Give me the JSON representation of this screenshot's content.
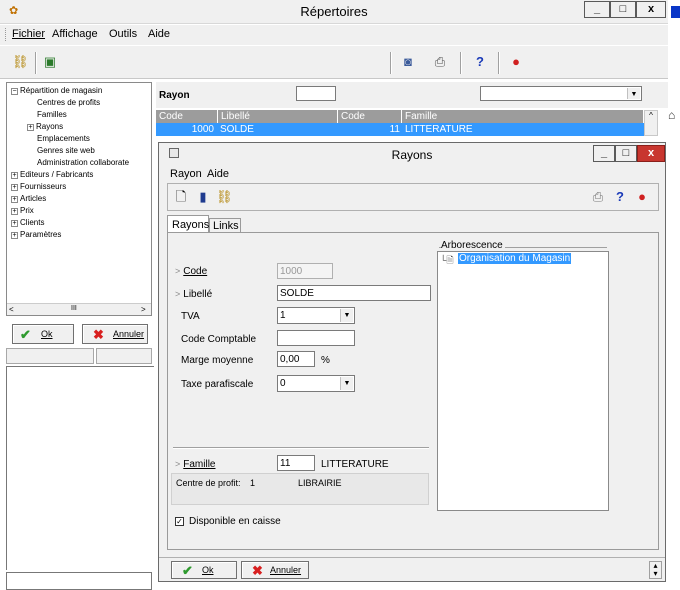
{
  "window": {
    "title": "Répertoires",
    "minimize": "_",
    "maximize": "□",
    "close": "x"
  },
  "menu": {
    "items": [
      {
        "label": "Fichier"
      },
      {
        "label": "Affichage"
      },
      {
        "label": "Outils"
      },
      {
        "label": "Aide"
      }
    ]
  },
  "tree": {
    "items": [
      {
        "label": "Répartition de magasin",
        "expander": "−"
      },
      {
        "label": "Centres de profits"
      },
      {
        "label": "Familles"
      },
      {
        "label": "Rayons",
        "expander": "+"
      },
      {
        "label": "Emplacements"
      },
      {
        "label": "Genres site web"
      },
      {
        "label": "Administration collaborate"
      },
      {
        "label": "Editeurs / Fabricants",
        "expander": "+"
      },
      {
        "label": "Fournisseurs",
        "expander": "+"
      },
      {
        "label": "Articles",
        "expander": "+"
      },
      {
        "label": "Prix",
        "expander": "+"
      },
      {
        "label": "Clients",
        "expander": "+"
      },
      {
        "label": "Paramètres",
        "expander": "+"
      }
    ],
    "scroll_thumb": "III"
  },
  "left_buttons": {
    "ok": "Ok",
    "cancel": "Annuler"
  },
  "rayon_search": {
    "label": "Rayon",
    "code_value": "",
    "combo_value": ""
  },
  "grid": {
    "headers": [
      "Code",
      "Libellé",
      "Code",
      "Famille"
    ],
    "rows": [
      {
        "code": "1000",
        "libelle": "SOLDE",
        "code2": "11",
        "famille": "LITTERATURE"
      }
    ]
  },
  "dialog": {
    "title": "Rayons",
    "minimize": "_",
    "maximize": "□",
    "close": "x",
    "menu": [
      {
        "label": "Rayon"
      },
      {
        "label": "Aide"
      }
    ],
    "tabs": [
      {
        "label": "Rayons"
      },
      {
        "label": "Links"
      }
    ],
    "form": {
      "code_label": "Code",
      "code_value": "1000",
      "libelle_label": "Libellé",
      "libelle_value": "SOLDE",
      "tva_label": "TVA",
      "tva_value": "1",
      "code_comptable_label": "Code Comptable",
      "code_comptable_value": "",
      "marge_label": "Marge moyenne",
      "marge_value": "0,00",
      "marge_unit": "%",
      "taxe_label": "Taxe parafiscale",
      "taxe_value": "0",
      "famille_label": "Famille",
      "famille_code": "11",
      "famille_name": "LITTERATURE",
      "centre_label": "Centre de profit:",
      "centre_code": "1",
      "centre_name": "LIBRAIRIE",
      "disponible_label": "Disponible en caisse",
      "disponible_checked": true
    },
    "arborescence": {
      "title": "Arborescence",
      "items": [
        {
          "label": "Organisation du Magasin"
        }
      ]
    },
    "buttons": {
      "ok": "Ok",
      "cancel": "Annuler"
    }
  }
}
